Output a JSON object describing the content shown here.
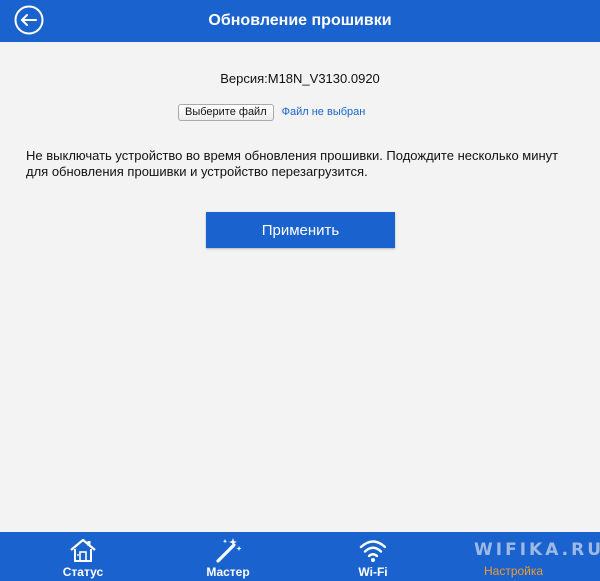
{
  "header": {
    "title": "Обновление прошивки",
    "back_icon": "arrow-left-circle-icon"
  },
  "firmware": {
    "version_text": "Версия:M18N_V3130.0920",
    "choose_file_label": "Выберите файл",
    "file_status": "Файл не выбран",
    "warning": "Не выключать устройство во время обновления прошивки. Подождите несколько минут для обновления прошивки и устройство перезагрузится.",
    "apply_label": "Применить"
  },
  "bottom_nav": {
    "items": [
      {
        "label": "Статус",
        "icon": "home-icon"
      },
      {
        "label": "Мастер",
        "icon": "magic-wand-icon"
      },
      {
        "label": "Wi-Fi",
        "icon": "wifi-icon"
      }
    ]
  },
  "watermark": {
    "top": "WIFIKA.RU",
    "bottom": "Настройка"
  },
  "colors": {
    "primary": "#1a63cf",
    "background": "#f3f3f3",
    "text": "#111111",
    "watermark_orange": "#f29a2b"
  }
}
